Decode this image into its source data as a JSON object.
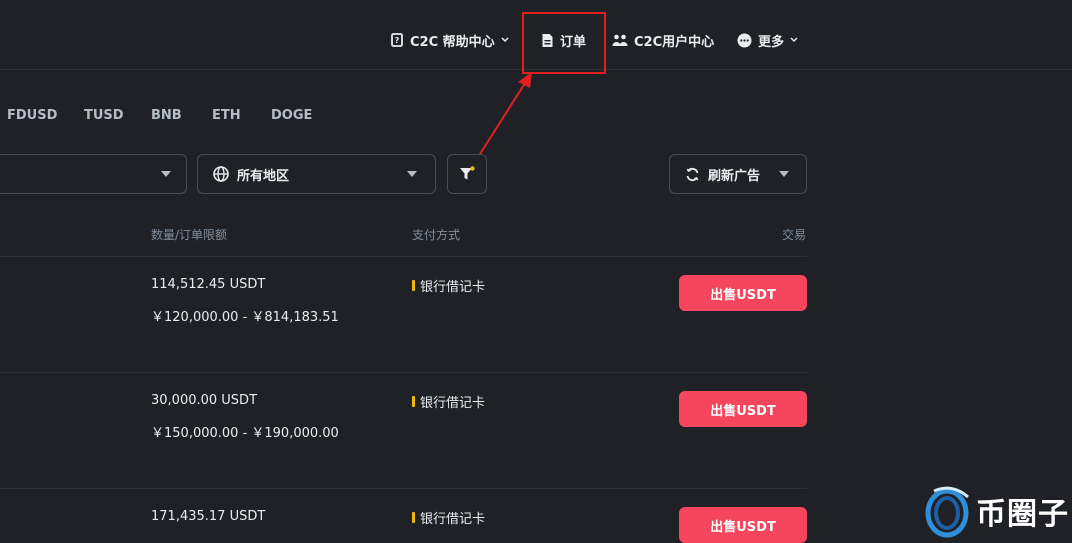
{
  "nav": {
    "help_center": "C2C 帮助中心",
    "orders": "订单",
    "user_center": "C2C用户中心",
    "more": "更多"
  },
  "coin_tabs": [
    "FDUSD",
    "TUSD",
    "BNB",
    "ETH",
    "DOGE"
  ],
  "filters": {
    "region": "所有地区",
    "refresh": "刷新广告"
  },
  "table": {
    "headers": {
      "quantity_limit": "数量/订单限额",
      "payment": "支付方式",
      "trade": "交易"
    },
    "rows": [
      {
        "quantity": "114,512.45 USDT",
        "limit": "￥120,000.00 - ￥814,183.51",
        "payment": "银行借记卡",
        "action": "出售USDT"
      },
      {
        "quantity": "30,000.00 USDT",
        "limit": "￥150,000.00 - ￥190,000.00",
        "payment": "银行借记卡",
        "action": "出售USDT"
      },
      {
        "quantity": "171,435.17 USDT",
        "limit": "",
        "payment": "银行借记卡",
        "action": "出售USDT"
      }
    ]
  },
  "watermark": {
    "text": "币圈子"
  },
  "colors": {
    "background": "#1f2126",
    "sell": "#f6465d",
    "accent": "#f0b90b",
    "highlight": "#e02020"
  }
}
